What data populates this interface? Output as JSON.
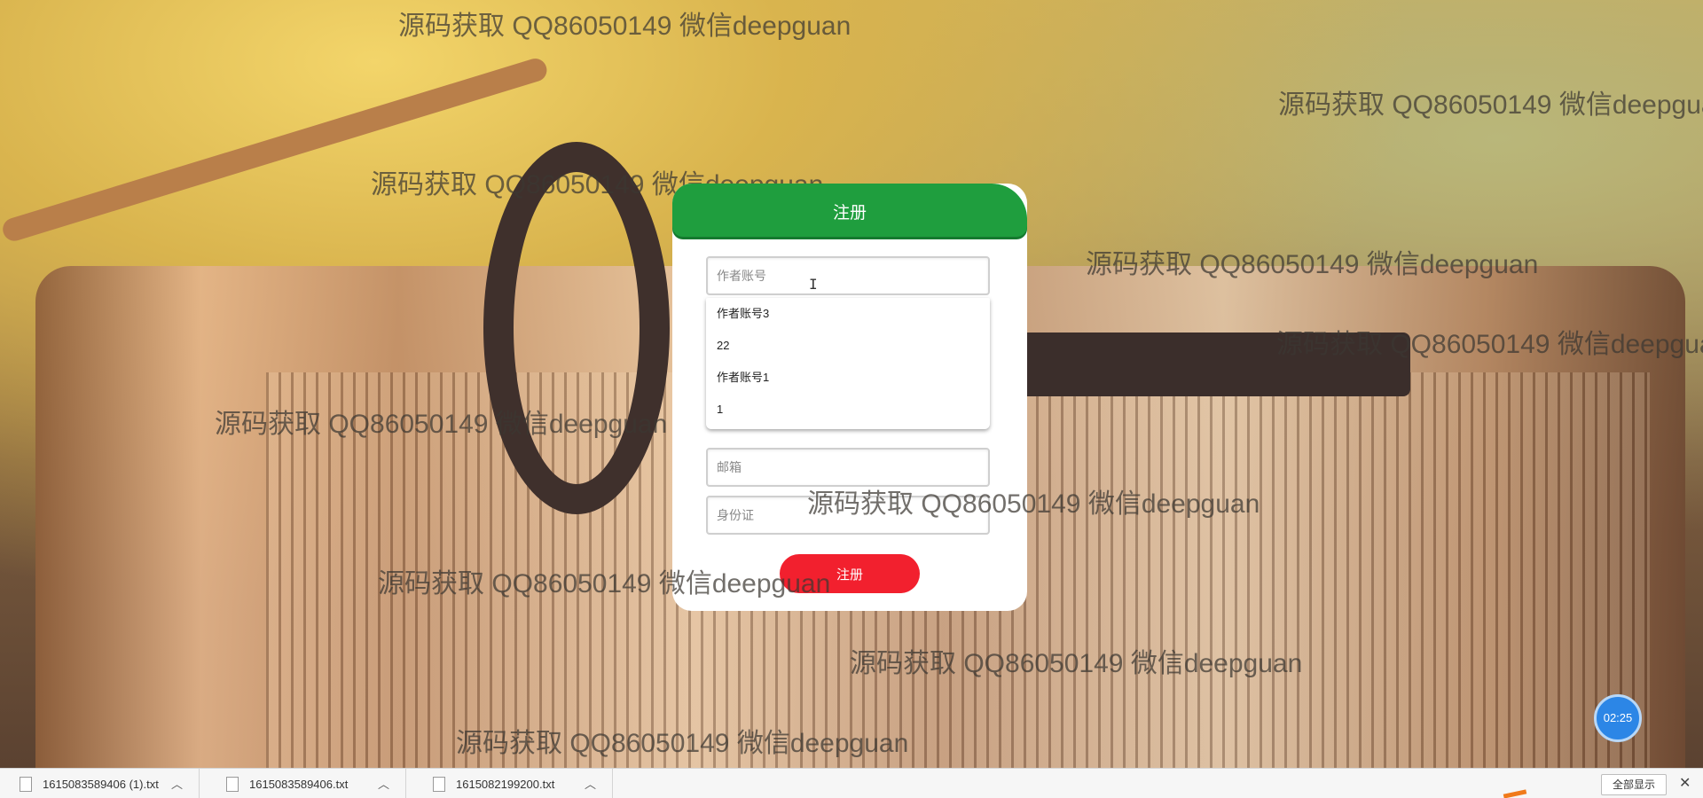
{
  "watermark_text": "源码获取 QQ86050149 微信deepguan",
  "register": {
    "title": "注册",
    "account_placeholder": "作者账号",
    "email_placeholder": "邮箱",
    "id_placeholder": "身份证",
    "submit_label": "注册",
    "autocomplete_items": [
      "作者账号3",
      "22",
      "作者账号1",
      "1"
    ]
  },
  "timer": "02:25",
  "downloads": {
    "items": [
      {
        "name": "1615083589406 (1).txt"
      },
      {
        "name": "1615083589406.txt"
      },
      {
        "name": "1615082199200.txt"
      }
    ],
    "show_all_label": "全部显示"
  },
  "colors": {
    "header_green": "#1f9e3e",
    "submit_red": "#f2202e",
    "timer_blue": "#2c86e6"
  }
}
